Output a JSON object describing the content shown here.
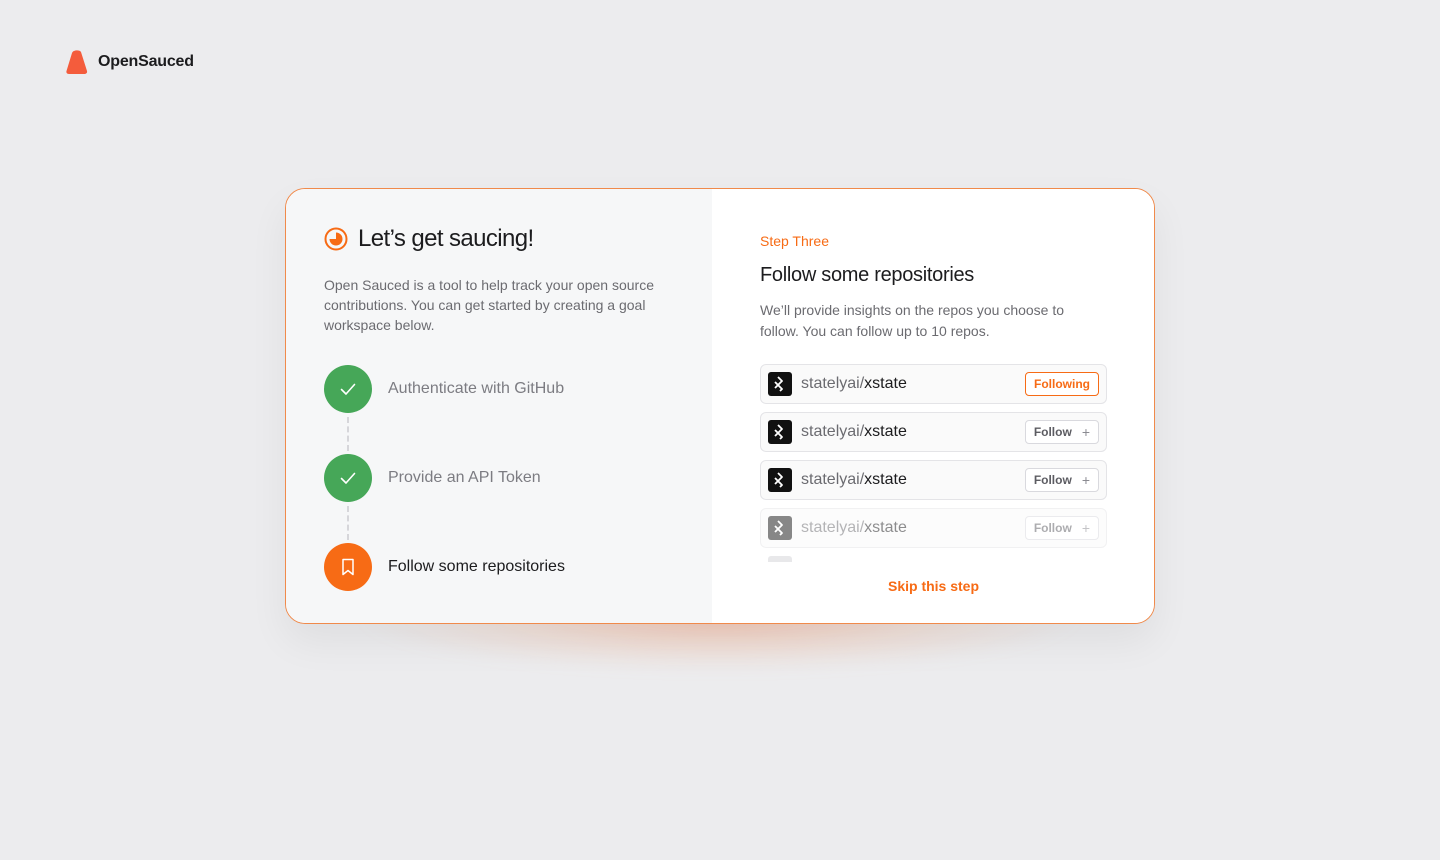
{
  "brand": {
    "name": "OpenSauced",
    "logo_icon": "opensauced-logo-icon",
    "color": "#f76b15"
  },
  "onboarding": {
    "heading": "Let’s get saucing!",
    "intro": "Open Sauced is a tool to help track your open source contributions. You can get started by creating a goal workspace below.",
    "steps": [
      {
        "label": "Authenticate with GitHub",
        "status": "done",
        "icon": "check-icon"
      },
      {
        "label": "Provide an API Token",
        "status": "done",
        "icon": "check-icon"
      },
      {
        "label": "Follow some repositories",
        "status": "active",
        "icon": "bookmark-icon"
      }
    ]
  },
  "step_panel": {
    "kicker": "Step Three",
    "title": "Follow some repositories",
    "description": "We’ll provide insights on the repos you choose to follow. You can follow up to 10 repos.",
    "repos": [
      {
        "owner": "statelyai",
        "separator": "/",
        "name": "xstate",
        "button": "Following",
        "state": "following"
      },
      {
        "owner": "statelyai",
        "separator": "/",
        "name": "xstate",
        "button": "Follow",
        "state": "follow"
      },
      {
        "owner": "statelyai",
        "separator": "/",
        "name": "xstate",
        "button": "Follow",
        "state": "follow"
      },
      {
        "owner": "statelyai",
        "separator": "/",
        "name": "xstate",
        "button": "Follow",
        "state": "follow"
      }
    ],
    "follow_plus": "+",
    "skip_label": "Skip this step"
  },
  "colors": {
    "accent": "#f76b15",
    "success": "#46a758",
    "background": "#ececee"
  }
}
